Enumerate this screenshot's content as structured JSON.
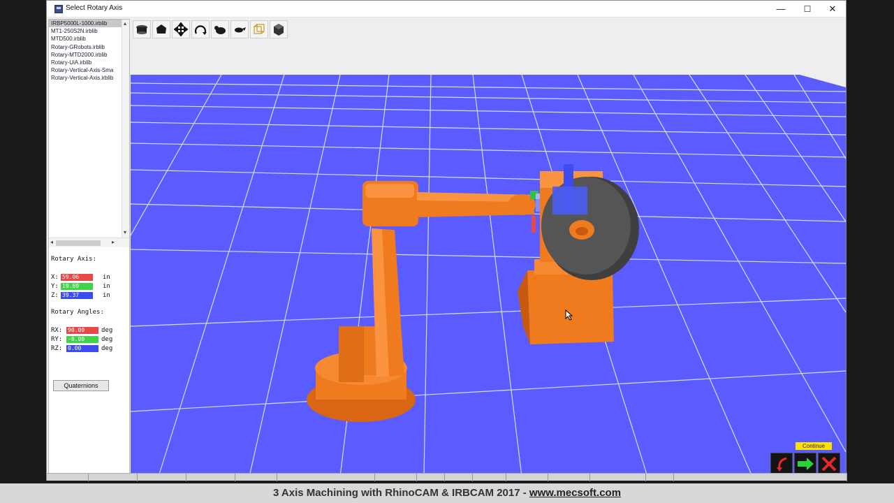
{
  "window": {
    "title": "Select Rotary Axis"
  },
  "controls": {
    "minimize": "—",
    "maximize": "☐",
    "close": "✕"
  },
  "library": {
    "items": [
      "IRBP5000L-1000.irblib",
      "MT1-250S2N.irblib",
      "MTD500.irblib",
      "Rotary-GRobots.irblib",
      "Rotary-MTD2000.irblib",
      "Rotary-UiA.irblib",
      "Rotary-Vertical-Axis-Sma",
      "Rotary-Vertical-Axis.irblib"
    ],
    "selected_index": 0
  },
  "rotary_axis": {
    "label": "Rotary Axis:",
    "x_label": "X:",
    "x_value": "59.06",
    "y_label": "Y:",
    "y_value": "19.69",
    "z_label": "Z:",
    "z_value": "39.37",
    "unit": "in"
  },
  "rotary_angles": {
    "label": "Rotary Angles:",
    "rx_label": "RX:",
    "rx_value": "90.00",
    "ry_label": "RY:",
    "ry_value": "-0.00",
    "rz_label": "RZ:",
    "rz_value": "0.00",
    "unit": "deg"
  },
  "buttons": {
    "quaternions": "Quaternions",
    "continue_label": "Continue"
  },
  "colors": {
    "x": "#e84848",
    "y": "#3fd44a",
    "z": "#3c4cf0",
    "floor": "#5a5cff",
    "robot": "#f07a1e",
    "disk": "#4a4a4a"
  },
  "toolbar_icons": [
    "view-top-icon",
    "view-perspective-icon",
    "pan-icon",
    "rotate-icon",
    "zoom-in-icon",
    "zoom-out-icon",
    "wireframe-icon",
    "shaded-icon"
  ],
  "caption": {
    "text": "3 Axis Machining with RhinoCAM & IRBCAM 2017 - ",
    "link": "www.mecsoft.com"
  }
}
